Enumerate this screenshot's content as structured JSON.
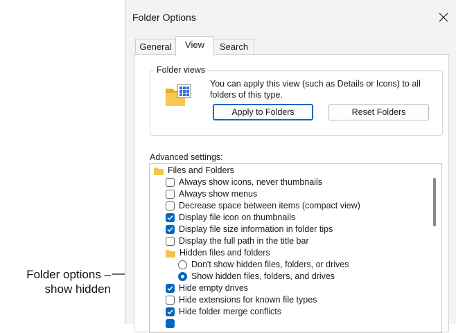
{
  "callout": {
    "line1": "Folder options –",
    "line2": "show hidden"
  },
  "dialog": {
    "title": "Folder Options",
    "tabs": [
      {
        "label": "General",
        "active": false
      },
      {
        "label": "View",
        "active": true
      },
      {
        "label": "Search",
        "active": false
      }
    ],
    "folder_views": {
      "legend": "Folder views",
      "description": "You can apply this view (such as Details or Icons) to all folders of this type.",
      "apply_button": "Apply to Folders",
      "reset_button": "Reset Folders"
    },
    "advanced": {
      "label": "Advanced settings:",
      "items": [
        {
          "type": "folder",
          "label": "Files and Folders"
        },
        {
          "type": "checkbox",
          "label": "Always show icons, never thumbnails",
          "checked": false
        },
        {
          "type": "checkbox",
          "label": "Always show menus",
          "checked": false
        },
        {
          "type": "checkbox",
          "label": "Decrease space between items (compact view)",
          "checked": false
        },
        {
          "type": "checkbox",
          "label": "Display file icon on thumbnails",
          "checked": true
        },
        {
          "type": "checkbox",
          "label": "Display file size information in folder tips",
          "checked": true
        },
        {
          "type": "checkbox",
          "label": "Display the full path in the title bar",
          "checked": false
        },
        {
          "type": "folder",
          "label": "Hidden files and folders"
        },
        {
          "type": "radio",
          "label": "Don't show hidden files, folders, or drives",
          "checked": false
        },
        {
          "type": "radio",
          "label": "Show hidden files, folders, and drives",
          "checked": true
        },
        {
          "type": "checkbox",
          "label": "Hide empty drives",
          "checked": true
        },
        {
          "type": "checkbox",
          "label": "Hide extensions for known file types",
          "checked": false
        },
        {
          "type": "checkbox",
          "label": "Hide folder merge conflicts",
          "checked": true
        }
      ]
    }
  },
  "colors": {
    "accent": "#0067c0",
    "folder": "#f4c34a",
    "dialog_bg": "#f3f3f3"
  }
}
